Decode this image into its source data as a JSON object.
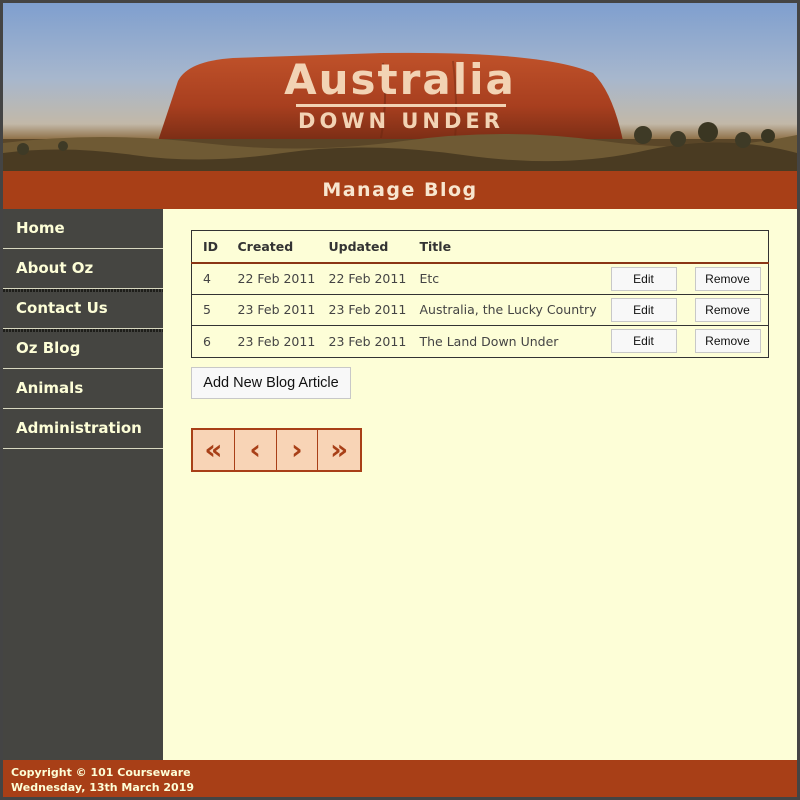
{
  "header": {
    "title": "Australia",
    "subtitle": "DOWN UNDER"
  },
  "page_heading": "Manage Blog",
  "sidebar": {
    "items": [
      {
        "label": "Home"
      },
      {
        "label": "About Oz"
      },
      {
        "label": "Contact Us"
      },
      {
        "label": "Oz Blog"
      },
      {
        "label": "Animals"
      },
      {
        "label": "Administration"
      }
    ]
  },
  "blog_table": {
    "headers": [
      "ID",
      "Created",
      "Updated",
      "Title"
    ],
    "rows": [
      {
        "id": "4",
        "created": "22 Feb 2011",
        "updated": "22 Feb 2011",
        "title": "Etc"
      },
      {
        "id": "5",
        "created": "23 Feb 2011",
        "updated": "23 Feb 2011",
        "title": "Australia, the Lucky Country"
      },
      {
        "id": "6",
        "created": "23 Feb 2011",
        "updated": "23 Feb 2011",
        "title": "The Land Down Under"
      }
    ],
    "edit_label": "Edit",
    "remove_label": "Remove"
  },
  "add_button_label": "Add New Blog Article",
  "pager": {
    "first": "«",
    "prev": "‹",
    "next": "›",
    "last": "»"
  },
  "footer": {
    "copyright": "Copyright © 101 Courseware",
    "date": "Wednesday, 13th March 2019"
  },
  "colors": {
    "accent": "#a83f17",
    "background": "#fdfed7",
    "sidebar": "#454541"
  }
}
